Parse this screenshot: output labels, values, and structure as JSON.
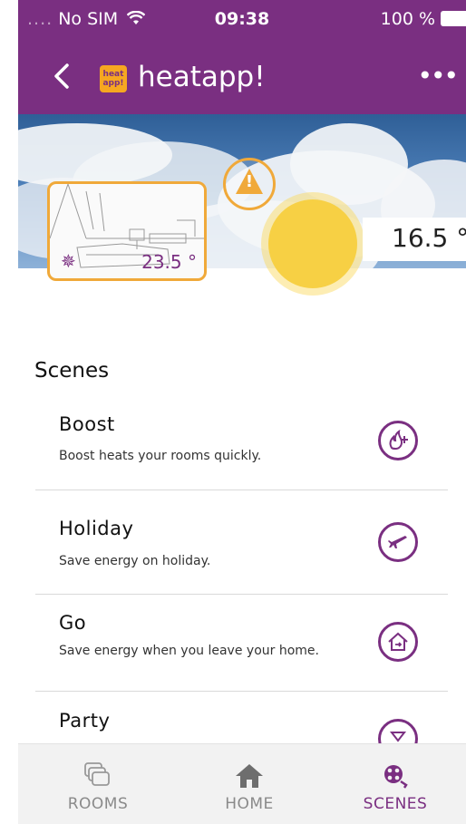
{
  "status_bar": {
    "carrier": "No SIM",
    "time": "09:38",
    "battery": "100 %"
  },
  "nav": {
    "title": "heatapp!",
    "logo_text": "heat app!"
  },
  "hero": {
    "room_temperature": "23.5 °",
    "outside_temperature": "16.5 °"
  },
  "scenes": {
    "title": "Scenes",
    "items": [
      {
        "name": "Boost",
        "description": "Boost heats your rooms quickly.",
        "icon": "flame-plus-icon"
      },
      {
        "name": "Holiday",
        "description": "Save energy on holiday.",
        "icon": "airplane-icon"
      },
      {
        "name": "Go",
        "description": "Save energy when you leave your home.",
        "icon": "house-leave-icon"
      },
      {
        "name": "Party",
        "description": "",
        "icon": "party-glass-icon"
      }
    ]
  },
  "tabbar": {
    "items": [
      {
        "label": "ROOMS",
        "icon": "rooms-icon"
      },
      {
        "label": "HOME",
        "icon": "home-icon"
      },
      {
        "label": "SCENES",
        "icon": "scenes-icon"
      }
    ],
    "active": "SCENES"
  },
  "colors": {
    "brand_purple": "#7a2f81",
    "accent_orange": "#f0a93a",
    "dial_yellow": "#f7d044"
  }
}
